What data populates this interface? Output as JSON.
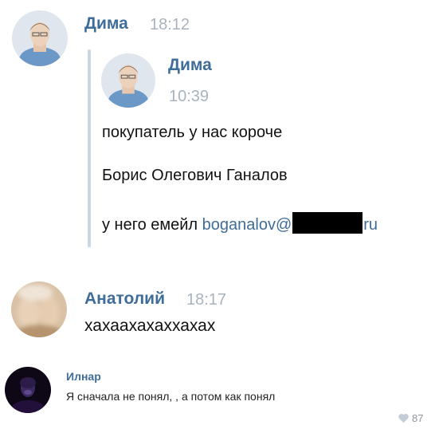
{
  "messages": [
    {
      "name": "Дима",
      "time": "18:12"
    },
    {
      "name": "Дима",
      "time": "10:39"
    },
    {
      "name": "Анатолий",
      "time": "18:17"
    }
  ],
  "forwarded": {
    "line1": "покупатель у нас короче",
    "line2": "Борис Олегович Ганалов",
    "line3_prefix": "у него емейл ",
    "email_start": "boganalov@",
    "email_end": "ru"
  },
  "anatoly_text": "хахаахахаххахах",
  "comment": {
    "name": "Илнар",
    "text": "Я сначала не понял, , а потом как понял",
    "likes": "87"
  },
  "colors": {
    "name": "#3f6d99",
    "time": "#a9b3bd",
    "quote_bar": "#c9d7e4"
  }
}
